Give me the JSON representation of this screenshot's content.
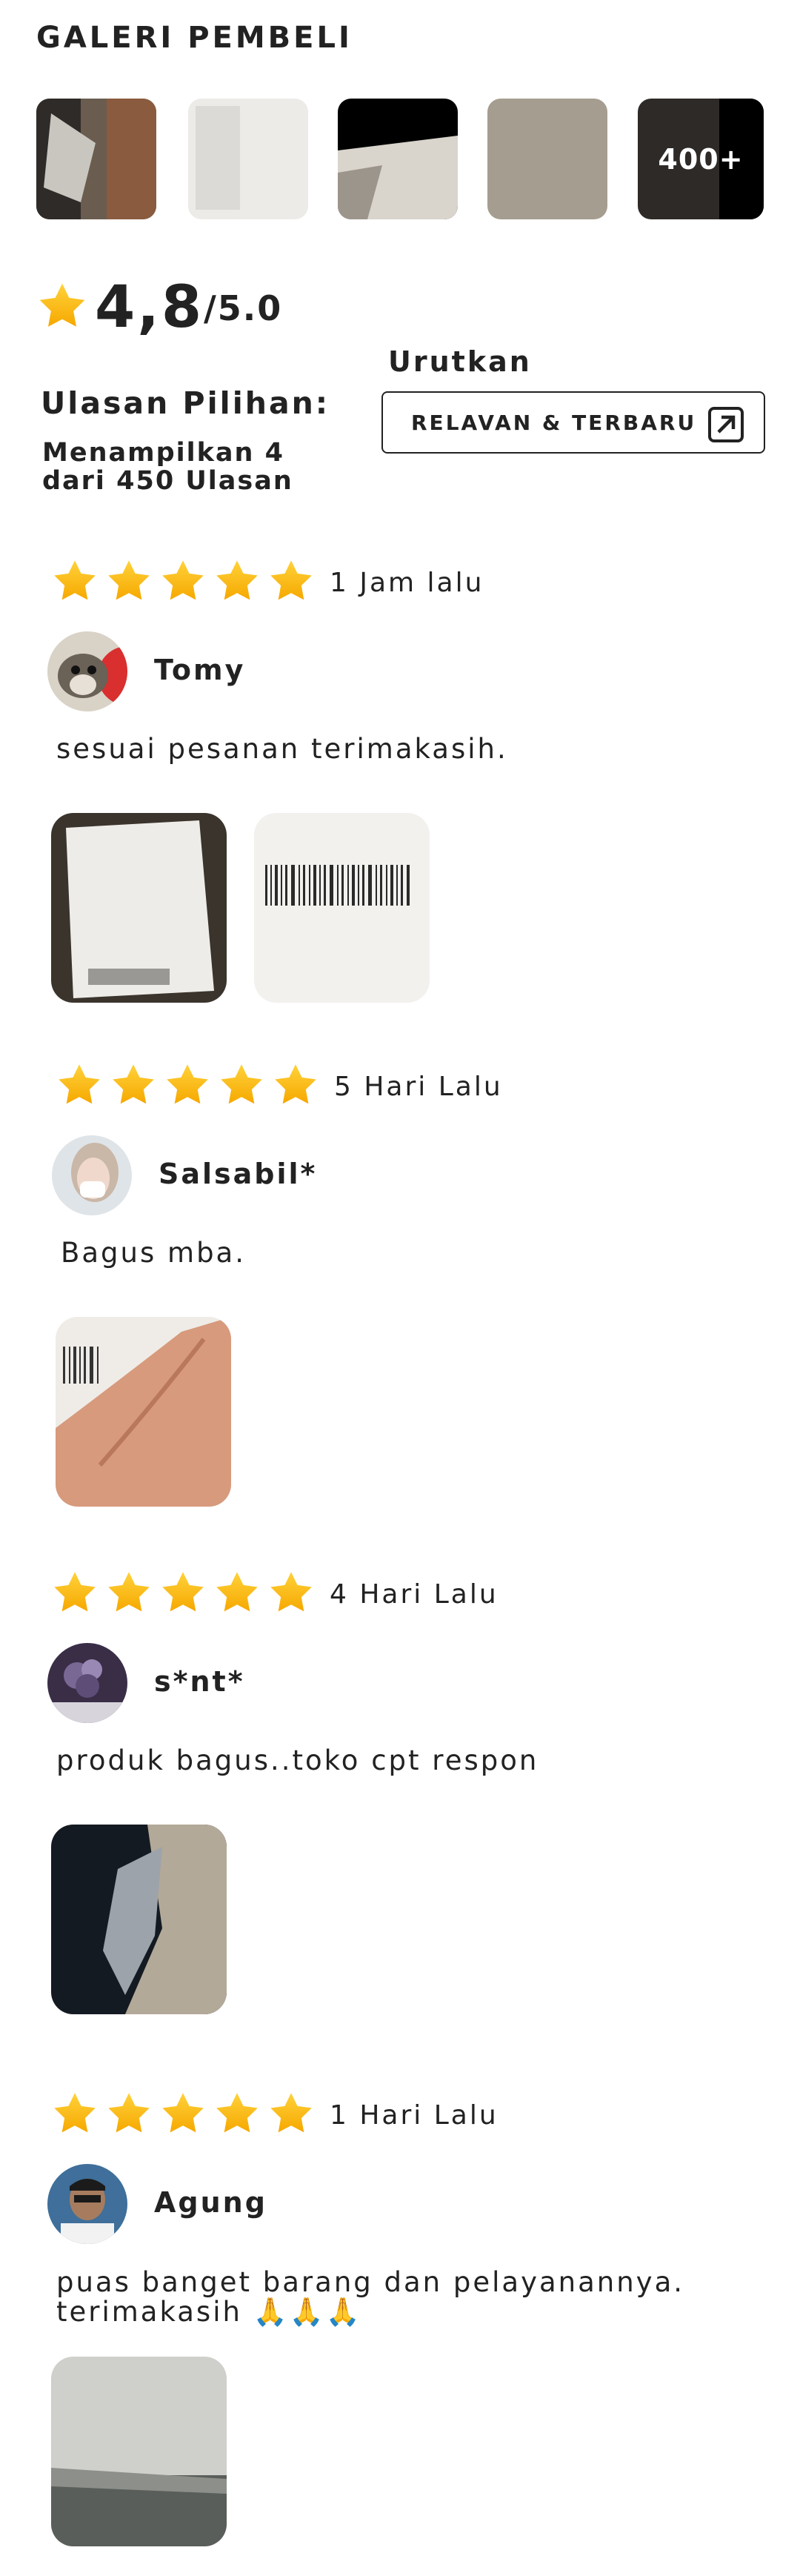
{
  "gallery": {
    "title": "GALERI PEMBELI",
    "more_label": "400+"
  },
  "summary": {
    "rating": "4,8",
    "max": "/5.0",
    "heading": "Ulasan Pilihan:",
    "count_text": "Menampilkan 4 dari 450 Ulasan"
  },
  "sort": {
    "label": "Urutkan",
    "button": "RELAVAN & TERBARU"
  },
  "colors": {
    "star": "#FDB813",
    "text": "#222222"
  },
  "reviews": [
    {
      "time": "1 Jam lalu",
      "name": "Tomy",
      "text": "sesuai pesanan terimakasih.",
      "stars": 5
    },
    {
      "time": "5 Hari Lalu",
      "name": "Salsabil*",
      "text": "Bagus mba.",
      "stars": 5
    },
    {
      "time": "4 Hari Lalu",
      "name": "s*nt*",
      "text": "produk bagus..toko cpt respon",
      "stars": 5
    },
    {
      "time": "1 Hari Lalu",
      "name": "Agung",
      "text": "puas banget barang dan pelayanannya. terimakasih 🙏🙏🙏",
      "stars": 5
    }
  ]
}
